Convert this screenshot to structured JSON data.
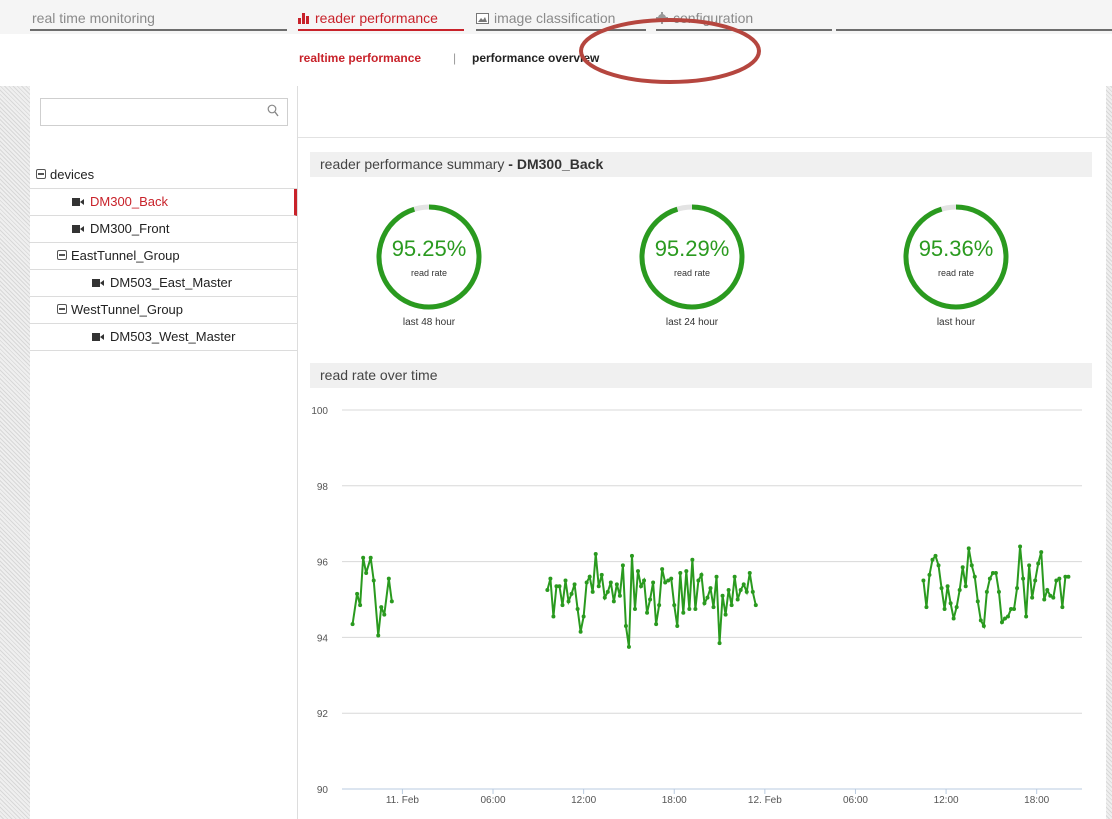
{
  "nav": {
    "tabs": [
      {
        "label": "real time monitoring",
        "icon": "none"
      },
      {
        "label": "reader performance",
        "icon": "bar-chart-icon"
      },
      {
        "label": "image classification",
        "icon": "image-icon"
      },
      {
        "label": "configuration",
        "icon": "gear-icon"
      }
    ],
    "subtabs": {
      "realtime": "realtime performance",
      "separator": "|",
      "overview": "performance overview"
    }
  },
  "search": {
    "placeholder": "",
    "value": ""
  },
  "tree": {
    "root": "devices",
    "items": [
      {
        "label": "DM300_Back",
        "type": "device",
        "selected": true
      },
      {
        "label": "DM300_Front",
        "type": "device"
      },
      {
        "label": "EastTunnel_Group",
        "type": "group"
      },
      {
        "label": "DM503_East_Master",
        "type": "device"
      },
      {
        "label": "WestTunnel_Group",
        "type": "group"
      },
      {
        "label": "DM503_West_Master",
        "type": "device"
      }
    ]
  },
  "summary": {
    "title": "reader performance summary",
    "device": "- DM300_Back",
    "gauges": [
      {
        "value": "95.25%",
        "label": "read rate",
        "caption": "last 48 hour",
        "fraction": 0.9525
      },
      {
        "value": "95.29%",
        "label": "read rate",
        "caption": "last 24 hour",
        "fraction": 0.9529
      },
      {
        "value": "95.36%",
        "label": "read rate",
        "caption": "last hour",
        "fraction": 0.9536
      }
    ]
  },
  "chart_panel": {
    "title": "read rate over time"
  },
  "colors": {
    "accent": "#c8222a",
    "gauge": "#2a9a1f",
    "line": "#2a9a1f"
  },
  "chart_data": {
    "type": "line",
    "ylim": [
      90,
      100
    ],
    "yticks": [
      90,
      92,
      94,
      96,
      98,
      100
    ],
    "xtick_labels": [
      "11. Feb",
      "06:00",
      "12:00",
      "18:00",
      "12. Feb",
      "06:00",
      "12:00",
      "18:00"
    ],
    "xtick_hours": [
      0,
      6,
      12,
      18,
      24,
      30,
      36,
      42
    ],
    "x_unit": "hours from 11. Feb 00:00",
    "xlim": [
      -4,
      45
    ],
    "grid": true,
    "segments": [
      {
        "x": [
          -3.3,
          -3.0,
          -2.8,
          -2.6,
          -2.4,
          -2.1,
          -1.9,
          -1.6,
          -1.4,
          -1.2,
          -0.9,
          -0.7
        ],
        "y": [
          94.35,
          95.15,
          94.85,
          96.1,
          95.7,
          96.1,
          95.5,
          94.05,
          94.8,
          94.6,
          95.55,
          94.95
        ]
      },
      {
        "x": [
          9.6,
          9.8,
          10.0,
          10.2,
          10.4,
          10.6,
          10.8,
          11.0,
          11.2,
          11.4,
          11.6,
          11.8,
          12.0,
          12.2,
          12.4,
          12.6,
          12.8,
          13.0,
          13.2,
          13.4,
          13.6,
          13.8,
          14.0,
          14.2,
          14.4,
          14.6,
          14.8,
          15.0,
          15.2,
          15.4,
          15.6,
          15.8,
          16.0,
          16.2,
          16.4,
          16.6,
          16.8,
          17.0,
          17.2,
          17.4,
          17.6,
          17.8,
          18.0,
          18.2,
          18.4,
          18.6,
          18.8,
          19.0,
          19.2,
          19.4,
          19.6,
          19.8,
          20.0,
          20.2,
          20.4,
          20.6,
          20.8,
          21.0,
          21.2,
          21.4,
          21.6,
          21.8,
          22.0,
          22.2,
          22.4,
          22.6,
          22.8,
          23.0,
          23.2,
          23.4
        ],
        "y": [
          95.25,
          95.55,
          94.55,
          95.35,
          95.35,
          94.85,
          95.5,
          94.95,
          95.15,
          95.4,
          94.75,
          94.15,
          94.55,
          95.45,
          95.6,
          95.2,
          96.2,
          95.35,
          95.65,
          95.05,
          95.2,
          95.45,
          94.95,
          95.4,
          95.1,
          95.9,
          94.3,
          93.75,
          96.15,
          94.75,
          95.75,
          95.35,
          95.5,
          94.65,
          95.0,
          95.45,
          94.35,
          94.85,
          95.8,
          95.45,
          95.5,
          95.55,
          94.85,
          94.3,
          95.7,
          94.65,
          95.75,
          94.75,
          96.05,
          94.75,
          95.5,
          95.65,
          94.9,
          95.05,
          95.3,
          94.8,
          95.6,
          93.85,
          95.1,
          94.6,
          95.25,
          94.85,
          95.6,
          95.0,
          95.25,
          95.4,
          95.2,
          95.7,
          95.2,
          94.85
        ],
        "y_note": ""
      },
      {
        "x": [
          34.5,
          34.7,
          34.9,
          35.1,
          35.3,
          35.5,
          35.7,
          35.9,
          36.1,
          36.3,
          36.5,
          36.7,
          36.9,
          37.1,
          37.3,
          37.5,
          37.7,
          37.9,
          38.1,
          38.3,
          38.5,
          38.7,
          38.9,
          39.1,
          39.3,
          39.5,
          39.7,
          39.9,
          40.1,
          40.3,
          40.5,
          40.7,
          40.9,
          41.1,
          41.3,
          41.5,
          41.7,
          41.9,
          42.1,
          42.3,
          42.5,
          42.7,
          42.9,
          43.1,
          43.3,
          43.5,
          43.7,
          43.9,
          44.1
        ],
        "y": [
          95.5,
          94.8,
          95.65,
          96.05,
          96.15,
          95.9,
          95.3,
          94.75,
          95.35,
          94.9,
          94.5,
          94.8,
          95.25,
          95.85,
          95.35,
          96.35,
          95.9,
          95.6,
          94.95,
          94.45,
          94.3,
          95.2,
          95.55,
          95.7,
          95.7,
          95.2,
          94.4,
          94.5,
          94.55,
          94.75,
          94.75,
          95.3,
          96.4,
          95.55,
          94.55,
          95.9,
          95.05,
          95.5,
          95.95,
          96.25,
          95.0,
          95.25,
          95.1,
          95.05,
          95.5,
          95.55,
          94.8,
          95.6,
          95.6
        ]
      }
    ]
  }
}
